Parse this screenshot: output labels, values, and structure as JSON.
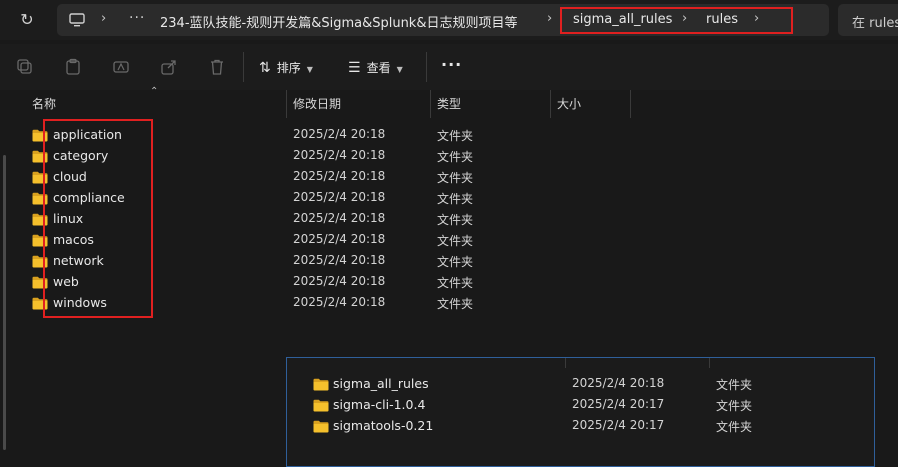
{
  "address_bar": {
    "overflow_label": "···",
    "crumbs": [
      "234-蓝队技能-规则开发篇&Sigma&Splunk&日志规则项目等",
      "sigma_all_rules",
      "rules"
    ]
  },
  "search": {
    "placeholder": "在 rules"
  },
  "toolbar": {
    "sort_label": "排序",
    "view_label": "查看",
    "more_label": "···"
  },
  "columns": {
    "name": "名称",
    "modified": "修改日期",
    "type": "类型",
    "size": "大小"
  },
  "files": [
    {
      "name": "application",
      "modified": "2025/2/4 20:18",
      "type": "文件夹"
    },
    {
      "name": "category",
      "modified": "2025/2/4 20:18",
      "type": "文件夹"
    },
    {
      "name": "cloud",
      "modified": "2025/2/4 20:18",
      "type": "文件夹"
    },
    {
      "name": "compliance",
      "modified": "2025/2/4 20:18",
      "type": "文件夹"
    },
    {
      "name": "linux",
      "modified": "2025/2/4 20:18",
      "type": "文件夹"
    },
    {
      "name": "macos",
      "modified": "2025/2/4 20:18",
      "type": "文件夹"
    },
    {
      "name": "network",
      "modified": "2025/2/4 20:18",
      "type": "文件夹"
    },
    {
      "name": "web",
      "modified": "2025/2/4 20:18",
      "type": "文件夹"
    },
    {
      "name": "windows",
      "modified": "2025/2/4 20:18",
      "type": "文件夹"
    }
  ],
  "overlay_files": [
    {
      "name": "sigma_all_rules",
      "modified": "2025/2/4 20:18",
      "type": "文件夹"
    },
    {
      "name": "sigma-cli-1.0.4",
      "modified": "2025/2/4 20:17",
      "type": "文件夹"
    },
    {
      "name": "sigmatools-0.21",
      "modified": "2025/2/4 20:17",
      "type": "文件夹"
    }
  ],
  "colors": {
    "folder": "#f5c02c",
    "highlight": "#e02020",
    "overlay_border": "#2f5f9a"
  }
}
